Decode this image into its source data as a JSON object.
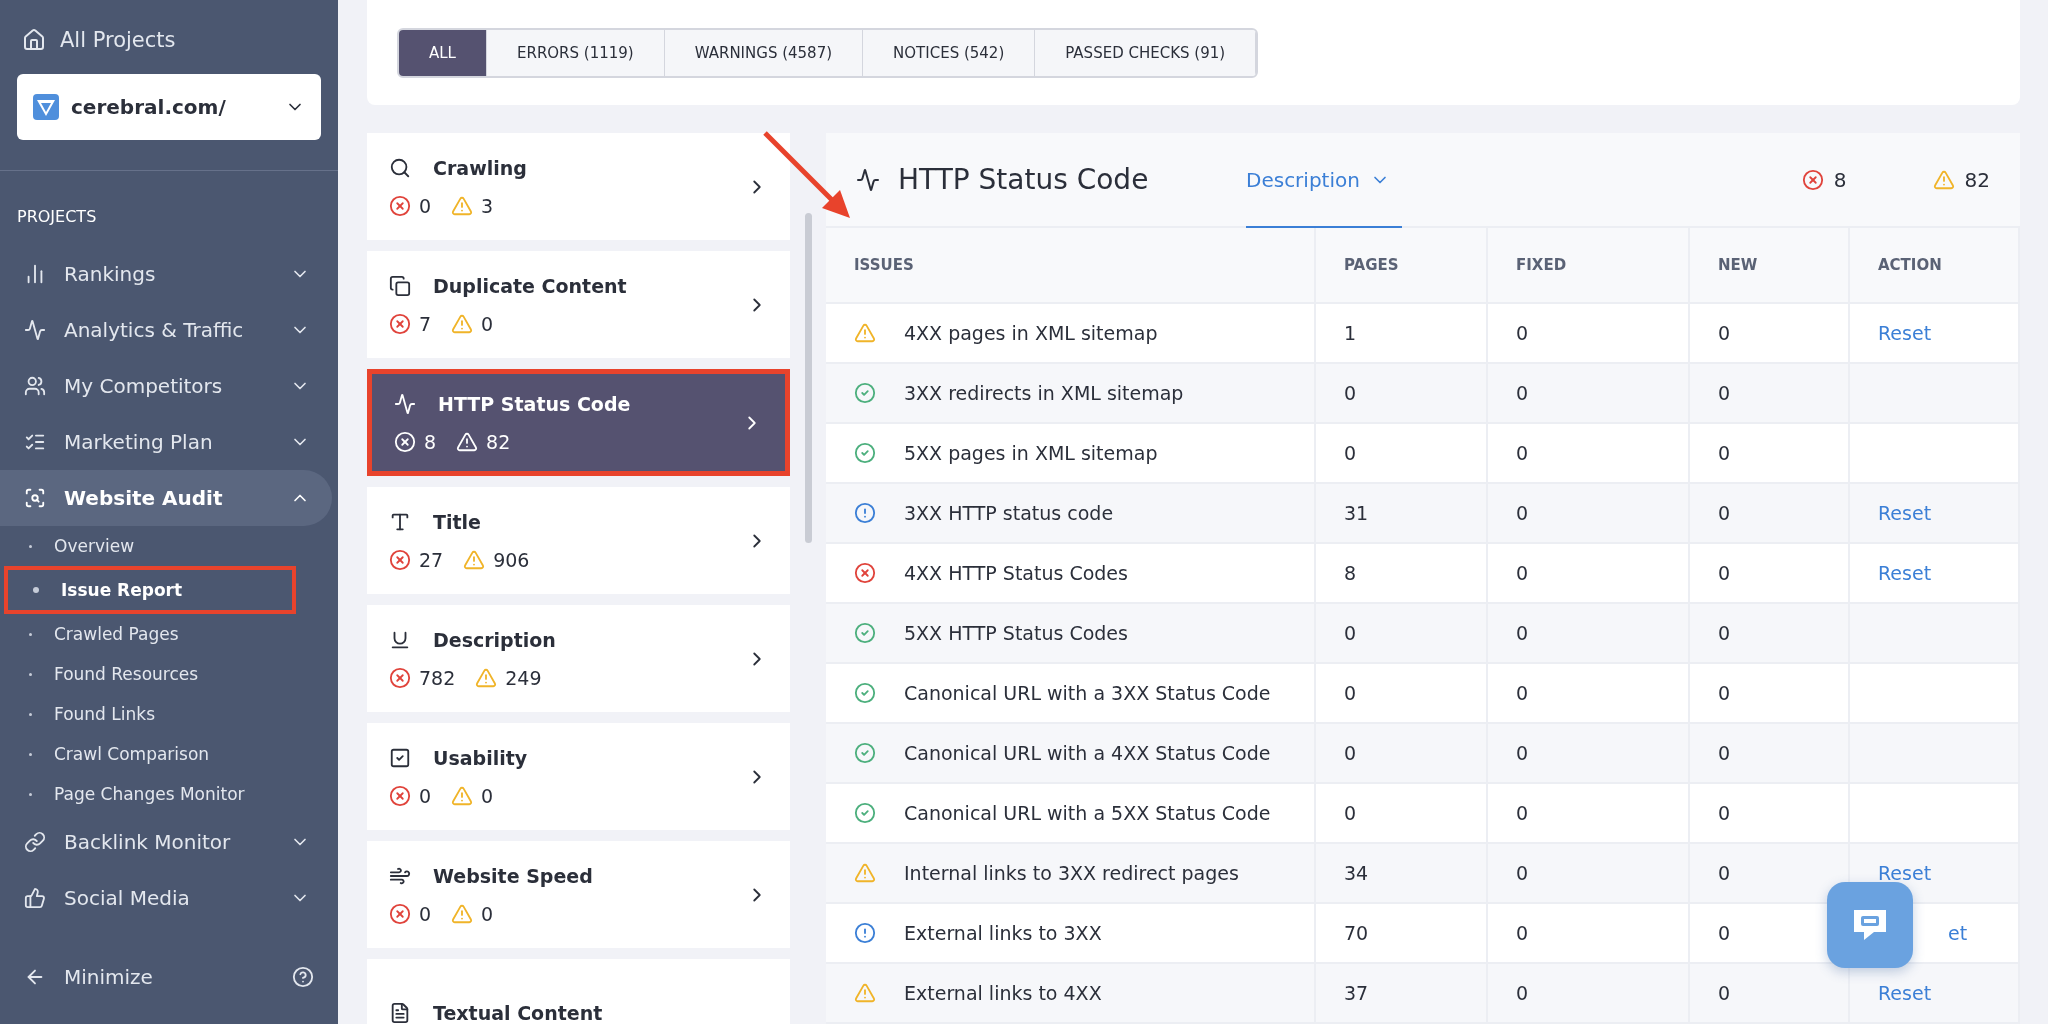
{
  "sidebar": {
    "all_projects": "All Projects",
    "project": "cerebral.com/",
    "section_label": "PROJECTS",
    "items": [
      {
        "label": "Rankings",
        "expanded": false
      },
      {
        "label": "Analytics & Traffic",
        "expanded": false
      },
      {
        "label": "My Competitors",
        "expanded": false
      },
      {
        "label": "Marketing Plan",
        "expanded": false
      },
      {
        "label": "Website Audit",
        "expanded": true,
        "selected": true,
        "children": [
          {
            "label": "Overview",
            "selected": false,
            "highlighted": false
          },
          {
            "label": "Issue Report",
            "selected": true,
            "highlighted": true
          },
          {
            "label": "Crawled Pages",
            "selected": false,
            "highlighted": false
          },
          {
            "label": "Found Resources",
            "selected": false,
            "highlighted": false
          },
          {
            "label": "Found Links",
            "selected": false,
            "highlighted": false
          },
          {
            "label": "Crawl Comparison",
            "selected": false,
            "highlighted": false
          },
          {
            "label": "Page Changes Monitor",
            "selected": false,
            "highlighted": false
          }
        ]
      },
      {
        "label": "Backlink Monitor",
        "expanded": false
      },
      {
        "label": "Social Media",
        "expanded": false
      }
    ],
    "minimize": "Minimize"
  },
  "filters": [
    {
      "label": "ALL",
      "selected": true
    },
    {
      "label": "ERRORS (1119)",
      "selected": false
    },
    {
      "label": "WARNINGS (4587)",
      "selected": false
    },
    {
      "label": "NOTICES (542)",
      "selected": false
    },
    {
      "label": "PASSED CHECKS (91)",
      "selected": false
    }
  ],
  "categories": [
    {
      "title": "Crawling",
      "errors": "0",
      "warnings": "3",
      "selected": false
    },
    {
      "title": "Duplicate Content",
      "errors": "7",
      "warnings": "0",
      "selected": false
    },
    {
      "title": "HTTP Status Code",
      "errors": "8",
      "warnings": "82",
      "selected": true,
      "highlighted": true
    },
    {
      "title": "Title",
      "errors": "27",
      "warnings": "906",
      "selected": false
    },
    {
      "title": "Description",
      "errors": "782",
      "warnings": "249",
      "selected": false
    },
    {
      "title": "Usability",
      "errors": "0",
      "warnings": "0",
      "selected": false
    },
    {
      "title": "Website Speed",
      "errors": "0",
      "warnings": "0",
      "selected": false
    },
    {
      "title": "Textual Content",
      "selected": false
    }
  ],
  "detail": {
    "title": "HTTP Status Code",
    "tab": "Description",
    "errors": "8",
    "warnings": "82",
    "columns": [
      "ISSUES",
      "PAGES",
      "FIXED",
      "NEW",
      "ACTION"
    ],
    "rows": [
      {
        "kind": "warning",
        "issue": "4XX pages in XML sitemap",
        "pages": "1",
        "fixed": "0",
        "new": "0",
        "action": "Reset"
      },
      {
        "kind": "passed",
        "issue": "3XX redirects in XML sitemap",
        "pages": "0",
        "fixed": "0",
        "new": "0"
      },
      {
        "kind": "passed",
        "issue": "5XX pages in XML sitemap",
        "pages": "0",
        "fixed": "0",
        "new": "0"
      },
      {
        "kind": "notice",
        "issue": "3XX HTTP status code",
        "pages": "31",
        "fixed": "0",
        "new": "0",
        "action": "Reset"
      },
      {
        "kind": "error",
        "issue": "4XX HTTP Status Codes",
        "pages": "8",
        "fixed": "0",
        "new": "0",
        "action": "Reset"
      },
      {
        "kind": "passed",
        "issue": "5XX HTTP Status Codes",
        "pages": "0",
        "fixed": "0",
        "new": "0"
      },
      {
        "kind": "passed",
        "issue": "Canonical URL with a 3XX Status Code",
        "pages": "0",
        "fixed": "0",
        "new": "0"
      },
      {
        "kind": "passed",
        "issue": "Canonical URL with a 4XX Status Code",
        "pages": "0",
        "fixed": "0",
        "new": "0"
      },
      {
        "kind": "passed",
        "issue": "Canonical URL with a 5XX Status Code",
        "pages": "0",
        "fixed": "0",
        "new": "0"
      },
      {
        "kind": "warning",
        "issue": "Internal links to 3XX redirect pages",
        "pages": "34",
        "fixed": "0",
        "new": "0",
        "action": "Reset"
      },
      {
        "kind": "notice",
        "issue": "External links to 3XX",
        "pages": "70",
        "fixed": "0",
        "new": "0",
        "action": "et",
        "covered": true
      },
      {
        "kind": "warning",
        "issue": "External links to 4XX",
        "pages": "37",
        "fixed": "0",
        "new": "0",
        "action": "Reset"
      }
    ]
  }
}
